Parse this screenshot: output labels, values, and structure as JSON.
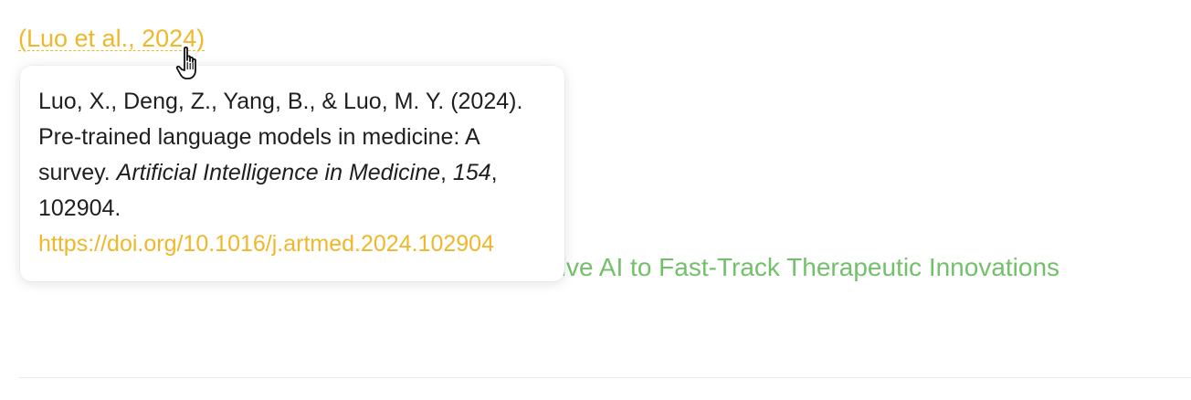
{
  "citation": {
    "label": "(Luo et al., 2024)"
  },
  "background": {
    "visible_link_text": "tive AI to Fast-Track Therapeutic Innovations"
  },
  "tooltip": {
    "authors_year_title": "Luo, X., Deng, Z., Yang, B., & Luo, M. Y. (2024). Pre-trained language models in medicine: A survey. ",
    "journal": "Artificial Intelligence in Medicine",
    "sep1": ", ",
    "volume": "154",
    "article_number": ", 102904.",
    "doi": "https://doi.org/10.1016/j.artmed.2024.102904"
  },
  "colors": {
    "link_accent": "#efb72a",
    "background_link": "#72c16a"
  },
  "icons": {
    "cursor": "hand-pointer-icon"
  }
}
